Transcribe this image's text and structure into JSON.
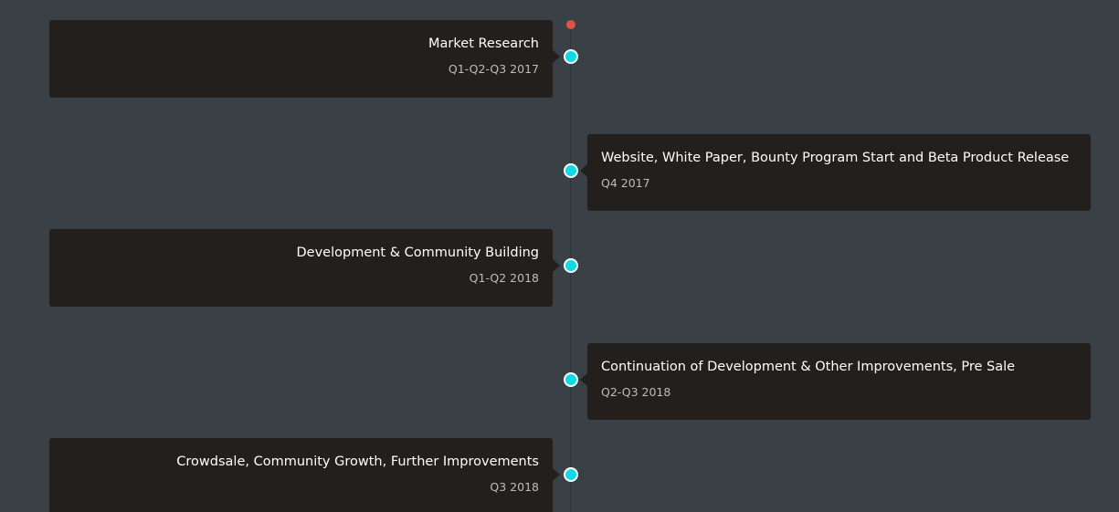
{
  "colors": {
    "background": "#394146",
    "card": "#221f1d",
    "node": "#11d9e8",
    "start_dot": "#e2533f"
  },
  "milestones": [
    {
      "title": "Market Research",
      "date": "Q1-Q2-Q3 2017",
      "side": "left"
    },
    {
      "title": "Website, White Paper, Bounty Program Start and Beta Product Release",
      "date": "Q4 2017",
      "side": "right"
    },
    {
      "title": "Development & Community Building",
      "date": "Q1-Q2 2018",
      "side": "left"
    },
    {
      "title": "Continuation of Development & Other Improvements, Pre Sale",
      "date": "Q2-Q3 2018",
      "side": "right"
    },
    {
      "title": "Crowdsale, Community Growth, Further Improvements",
      "date": "Q3 2018",
      "side": "left"
    }
  ]
}
